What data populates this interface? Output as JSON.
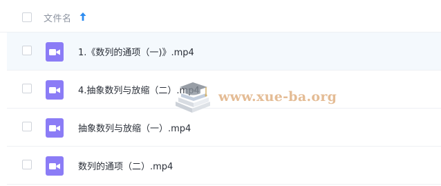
{
  "header": {
    "column_label": "文件名",
    "sort_icon": "arrow-up-icon",
    "sort_color": "#2d8cf0"
  },
  "files": [
    {
      "name": "1.《数列的通项（一)》.mp4",
      "icon": "video-file-icon",
      "selected": true
    },
    {
      "name": "4.抽象数列与放缩（二）.mp4",
      "icon": "video-file-icon",
      "selected": false
    },
    {
      "name": "抽象数列与放缩（一）.mp4",
      "icon": "video-file-icon",
      "selected": false
    },
    {
      "name": "数列的通项（二）.mp4",
      "icon": "video-file-icon",
      "selected": false
    }
  ],
  "watermark": {
    "text": "www.xue-ba.org"
  },
  "colors": {
    "accent": "#2d8cf0",
    "video_icon": "#8b7cf6",
    "selected_row": "#f4f9fd",
    "watermark": "#e2b58a"
  }
}
